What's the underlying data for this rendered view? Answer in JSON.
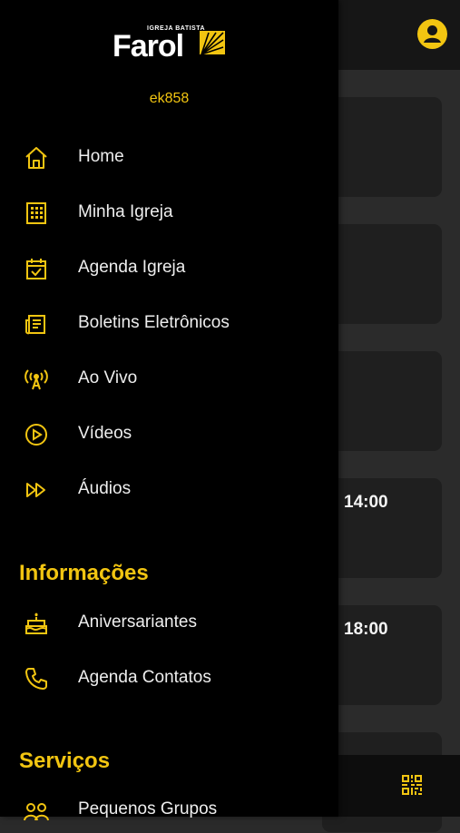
{
  "app": {
    "logo_small": "IGREJA BATISTA",
    "logo_main": "Farol",
    "user_code": "ek858"
  },
  "drawer": {
    "items": [
      {
        "label": "Home",
        "icon": "home-icon"
      },
      {
        "label": "Minha Igreja",
        "icon": "building-icon"
      },
      {
        "label": "Agenda Igreja",
        "icon": "calendar-check-icon"
      },
      {
        "label": "Boletins Eletrônicos",
        "icon": "newspaper-icon"
      },
      {
        "label": "Ao Vivo",
        "icon": "broadcast-icon"
      },
      {
        "label": "Vídeos",
        "icon": "play-circle-icon"
      },
      {
        "label": "Áudios",
        "icon": "fast-forward-icon"
      }
    ],
    "section_info": "Informações",
    "info_items": [
      {
        "label": "Aniversariantes",
        "icon": "cake-icon"
      },
      {
        "label": "Agenda Contatos",
        "icon": "phone-icon"
      }
    ],
    "section_services": "Serviços",
    "service_items": [
      {
        "label": "Pequenos Grupos",
        "icon": "group-icon"
      }
    ]
  },
  "background": {
    "times": [
      "14:00",
      "18:00"
    ]
  },
  "colors": {
    "accent": "#f2c511",
    "drawer_bg": "#000000",
    "card_bg": "#1f1f1f"
  }
}
